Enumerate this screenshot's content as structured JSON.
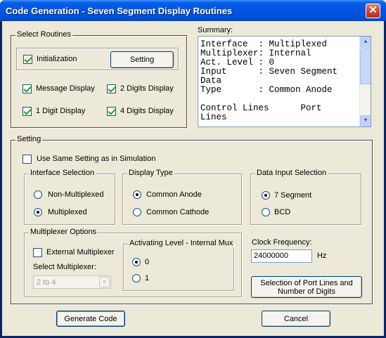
{
  "window": {
    "title": "Code Generation - Seven Segment Display Routines",
    "close_glyph": "✕"
  },
  "select_routines": {
    "legend": "Select Routines",
    "initialization": {
      "label": "Initialization",
      "checked": true
    },
    "setting_button": "Setting",
    "message_display": {
      "label": "Message Display",
      "checked": true
    },
    "two_digits_display": {
      "label": "2 Digits Display",
      "checked": true
    },
    "one_digit_display": {
      "label": "1 Digit Display",
      "checked": true
    },
    "four_digits_display": {
      "label": "4 Digits Display",
      "checked": true
    }
  },
  "summary": {
    "label": "Summary:",
    "text": "Interface  : Multiplexed\nMultiplexer: Internal\nAct. Level : 0\nInput      : Seven Segment\nData\nType       : Common Anode\n\nControl Lines      Port\nLines"
  },
  "setting": {
    "legend": "Setting",
    "use_same_setting": {
      "label": "Use Same Setting as in Simulation",
      "checked": false
    },
    "interface_selection": {
      "legend": "Interface Selection",
      "options": [
        "Non-Multiplexed",
        "Multiplexed"
      ],
      "selected": "Multiplexed"
    },
    "display_type": {
      "legend": "Display Type",
      "options": [
        "Common Anode",
        "Common Cathode"
      ],
      "selected": "Common Anode"
    },
    "data_input_selection": {
      "legend": "Data Input Selection",
      "options": [
        "7 Segment",
        "BCD"
      ],
      "selected": "7 Segment"
    },
    "multiplexer_options": {
      "legend": "Multiplexer Options",
      "external_multiplexer": {
        "label": "External Multiplexer",
        "checked": false
      },
      "select_multiplexer_label": "Select Multiplexer:",
      "select_multiplexer_value": "2 to 4"
    },
    "activating_level": {
      "legend": "Activating Level - Internal Mux",
      "options": [
        "0",
        "1"
      ],
      "selected": "0"
    },
    "clock_frequency": {
      "label": "Clock Frequency:",
      "value": "24000000",
      "unit": "Hz"
    },
    "port_lines_button": "Selection of Port Lines and Number  of Digits"
  },
  "buttons": {
    "generate": "Generate  Code",
    "cancel": "Cancel"
  }
}
